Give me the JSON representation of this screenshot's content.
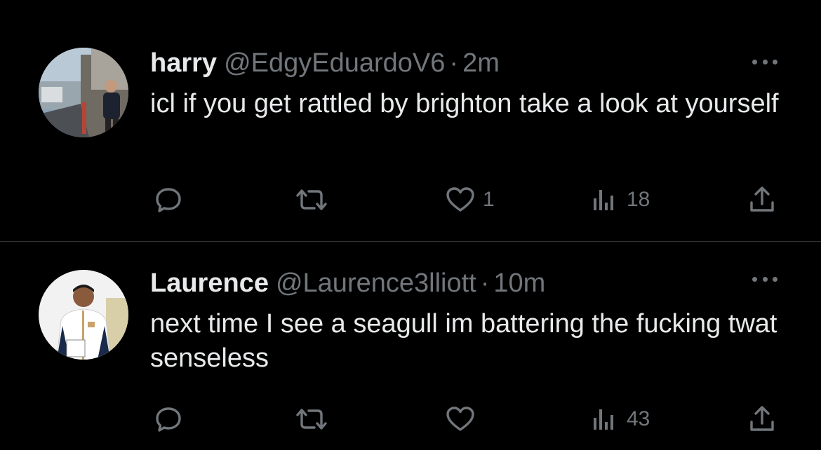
{
  "tweets": [
    {
      "author": {
        "name": "harry",
        "handle": "@EdgyEduardoV6"
      },
      "separator": "·",
      "time": "2m",
      "text": "icl if you get rattled by brighton take a look at yourself",
      "replies": "",
      "retweets": "",
      "likes": "1",
      "views": "18"
    },
    {
      "author": {
        "name": "Laurence",
        "handle": "@Laurence3lliott"
      },
      "separator": "·",
      "time": "10m",
      "text": "next time I see a seagull im battering the fucking twat senseless",
      "replies": "",
      "retweets": "",
      "likes": "",
      "views": "43"
    }
  ],
  "icons": {
    "reply": "reply-icon",
    "retweet": "retweet-icon",
    "like": "heart-icon",
    "views": "views-icon",
    "share": "share-icon",
    "more": "more-icon"
  },
  "colors": {
    "background": "#000000",
    "text_primary": "#e7e9ea",
    "text_secondary": "#71767b",
    "divider": "#2f3336"
  }
}
